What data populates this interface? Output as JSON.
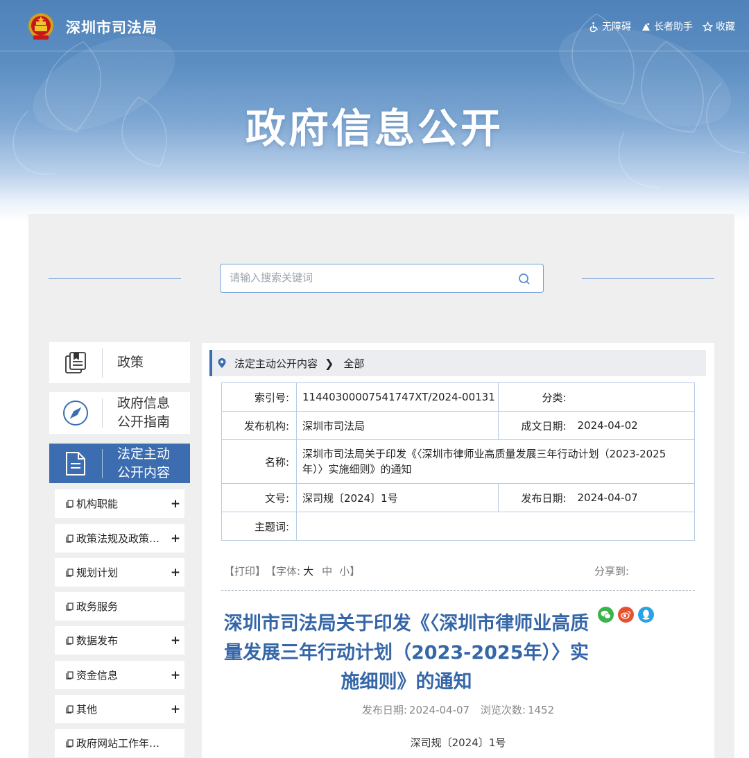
{
  "header": {
    "site_title": "深圳市司法局",
    "hero_title": "政府信息公开",
    "links": [
      {
        "icon": "wheelchair-icon",
        "label": "无障碍"
      },
      {
        "icon": "elder-icon",
        "label": "长者助手"
      },
      {
        "icon": "star-icon",
        "label": "收藏"
      }
    ]
  },
  "search": {
    "placeholder": "请输入搜索关键词"
  },
  "sidebar": {
    "cards": [
      {
        "label": "政策",
        "icon": "policy-book-icon"
      },
      {
        "label_lines": [
          "政府信息",
          "公开指南"
        ],
        "icon": "compass-icon"
      },
      {
        "label_lines": [
          "法定主动",
          "公开内容"
        ],
        "icon": "document-icon",
        "active": true
      }
    ],
    "items": [
      {
        "label": "机构职能",
        "expandable": true
      },
      {
        "label": "政策法规及政策…",
        "expandable": true
      },
      {
        "label": "规划计划",
        "expandable": true
      },
      {
        "label": "政务服务",
        "expandable": false
      },
      {
        "label": "数据发布",
        "expandable": true
      },
      {
        "label": "资金信息",
        "expandable": true
      },
      {
        "label": "其他",
        "expandable": true
      },
      {
        "label": "政府网站工作年…",
        "expandable": false
      }
    ],
    "plus": "+"
  },
  "breadcrumb": {
    "items": [
      "法定主动公开内容",
      "全部"
    ],
    "separator": "❯"
  },
  "meta": {
    "index_label": "索引号:",
    "index_value": "11440300007541747XT/2024-00131",
    "category_label": "分类:",
    "category_value": "",
    "publisher_label": "发布机构:",
    "publisher_value": "深圳市司法局",
    "written_date_label": "成文日期:",
    "written_date_value": "2024-04-02",
    "name_label": "名称:",
    "name_value": "深圳市司法局关于印发《〈深圳市律师业高质量发展三年行动计划（2023-2025年）〉实施细则》的通知",
    "docno_label": "文号:",
    "docno_value": "深司规〔2024〕1号",
    "pub_date_label": "发布日期:",
    "pub_date_value": "2024-04-07",
    "subject_label": "主题词:",
    "subject_value": ""
  },
  "tools": {
    "print": "【打印】",
    "font_prefix": "【字体:",
    "font_large": "大",
    "font_medium": "中",
    "font_small": "小】",
    "share_label": "分享到:"
  },
  "share_icons": [
    {
      "name": "wechat-icon",
      "color": "#3bb34a"
    },
    {
      "name": "weibo-icon",
      "color": "#e6512e"
    },
    {
      "name": "qq-icon",
      "color": "#2ba1e6"
    }
  ],
  "article": {
    "title": "深圳市司法局关于印发《〈深圳市律师业高质量发展三年行动计划（2023-2025年）〉实施细则》的通知",
    "pub_date_label": "发布日期:",
    "pub_date": "2024-04-07",
    "views_label": "浏览次数:",
    "views": "1452",
    "doc_number": "深司规〔2024〕1号"
  },
  "colors": {
    "primary": "#3b6db0",
    "title_blue": "#3566a8",
    "panel_bg": "#efefef"
  }
}
